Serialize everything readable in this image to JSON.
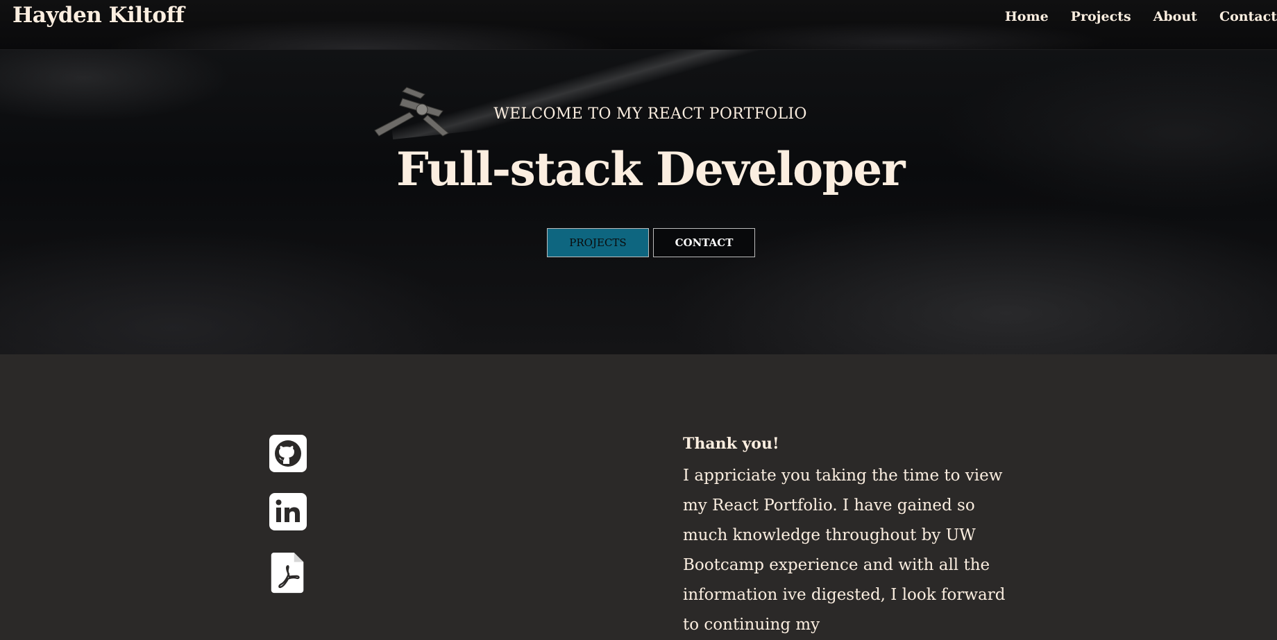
{
  "nav": {
    "brand": "Hayden Kiltoff",
    "links": [
      {
        "label": "Home"
      },
      {
        "label": "Projects"
      },
      {
        "label": "About"
      },
      {
        "label": "Contact"
      }
    ]
  },
  "hero": {
    "eyebrow": "WELCOME TO MY REACT PORTFOLIO",
    "title": "Full-stack Developer",
    "buttons": {
      "projects": "PROJECTS",
      "contact": "CONTACT"
    }
  },
  "about": {
    "social": [
      {
        "icon": "github-icon"
      },
      {
        "icon": "linkedin-icon"
      },
      {
        "icon": "pdf-resume-icon"
      }
    ],
    "thanks_title": "Thank you!",
    "thanks_body": "I appriciate you taking the time to view my React Portfolio. I have gained so much knowledge throughout by UW Bootcamp experience and with all the information ive digested, I look forward to continuing my"
  },
  "colors": {
    "text": "#fbeee0",
    "accent": "#0e6680",
    "section_bg": "#2b2928",
    "nav_bg": "#0c0c0d"
  }
}
